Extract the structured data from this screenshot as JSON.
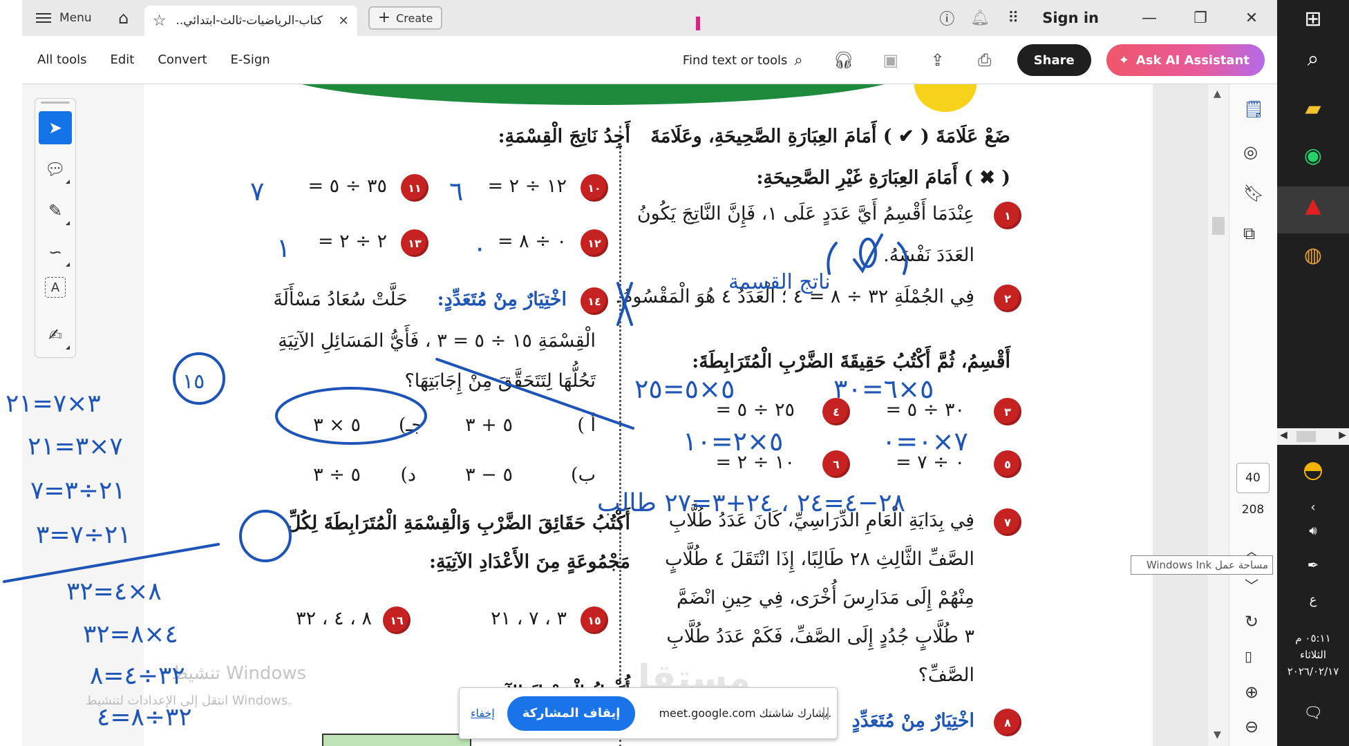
{
  "titlebar": {
    "menu_label": "Menu",
    "tab_title": "كتاب-الرياضيات-ثالث-ابتدائي..",
    "create_label": "Create",
    "sign_in_label": "Sign in"
  },
  "toolbar": {
    "all_tools": "All tools",
    "edit": "Edit",
    "convert": "Convert",
    "esign": "E-Sign",
    "find": "Find text or tools",
    "share": "Share",
    "ai_assistant": "Ask AI Assistant"
  },
  "document": {
    "right_col": {
      "heading1": "ضَعْ عَلَامَةَ ( ✔ ) أَمَامَ العِبَارَةِ الصَّحِيحَةِ، وعَلَامَةَ",
      "heading2": "( ✖ ) أَمَامَ العِبَارَةِ غَيْرِ الصَّحِيحَةِ:",
      "q1_num": "١",
      "q1_line1": "عِنْدَمَا أَقْسِمُ أَيَّ عَدَدٍ عَلَى ١، فَإِنَّ النَّاتِجَ يَكُونُ",
      "q1_line2": "العَدَدَ نَفْسَهُ.",
      "q2_num": "٢",
      "q2_text": "فِي الجُمْلَةِ ٣٢ ÷ ٨ = ٤ ؛ الْعَدَدُ ٤ هُوَ الْمَقْسُومُ.",
      "heading3": "أَقْسِمُ، ثُمَّ أَكْتُبُ حَقِيقَةَ الضَّرْبِ الْمُتَرَابِطَةَ:",
      "q3_num": "٣",
      "q3_expr": "٣٠ ÷ ٥ =",
      "q4_num": "٤",
      "q4_expr": "٢٥ ÷ ٥ =",
      "q5_num": "٥",
      "q5_expr": "٠ ÷ ٧ =",
      "q6_num": "٦",
      "q6_expr": "١٠ ÷ ٢ =",
      "q7_num": "٧",
      "q7_line1": "فِي بِدَايَةِ الْعَامِ الدِّرَاسِيِّ، كَانَ عَدَدُ طُلَّابِ",
      "q7_line2": "الصَّفِّ الثَّالِثِ ٢٨ طَالِبًا، إِذَا انْتَقَلَ ٤ طُلَّابٍ",
      "q7_line3": "مِنْهُمْ إِلَى مَدَارِسَ أُخْرَى، فِي حِينِ انْضَمَّ",
      "q7_line4": "٣ طُلَّابٍ جُدُدٍ إِلَى الصَّفِّ، فَكَمْ عَدَدُ طُلَّابِ",
      "q7_line5": "الصَّفِّ؟",
      "q8_num": "٨",
      "q8_text": "اخْتِيَارٌ مِنْ مُتَعَدِّدٍ"
    },
    "left_col": {
      "heading1": "أَجِدُ نَاتِجَ الْقِسْمَةِ:",
      "q10_num": "١٠",
      "q10_expr": "١٢ ÷ ٢ =",
      "q11_num": "١١",
      "q11_expr": "٣٥ ÷ ٥ =",
      "q12_num": "١٢",
      "q12_expr": "٠ ÷ ٨ =",
      "q13_num": "١٣",
      "q13_expr": "٢ ÷ ٢ =",
      "q14_num": "١٤",
      "q14_title": "اخْتِيَارٌ مِنْ مُتَعَدِّدٍ:",
      "q14_line1": "حَلَّتْ سُعَادُ مَسْأَلَةَ",
      "q14_line2": "الْقِسْمَةِ ١٥ ÷ ٥ = ٣ ، فَأَيُّ المَسَائِلِ الآتِيَةِ",
      "q14_line3": "تَحُلُّهَا لِتَتَحَقَّقَ مِنْ إِجَابَتِهَا؟",
      "opt_a_label": "أ )",
      "opt_a": "٥ + ٣",
      "opt_c_label": "جـ)",
      "opt_c": "٥ × ٣",
      "opt_b_label": "ب)",
      "opt_b": "٥ − ٣",
      "opt_d_label": "د)",
      "opt_d": "٥ ÷ ٣",
      "heading2": "أَكْتُبُ حَقَائِقَ الضَّرْبِ وَالْقِسْمَةِ الْمُتَرَابِطَةَ لِكُلِّ",
      "heading3": "مَجْمُوعَةٍ مِنَ الأَعْدَادِ الآتِيَةِ:",
      "q15_num": "١٥",
      "q15_set": "٣ ، ٧ ، ٢١",
      "q16_num": "١٦",
      "q16_set": "٨ ، ٤ ، ٣٢",
      "heading4": "أُكْمِلُ الْجَدْوَلَ الآتِيَ:"
    },
    "watermark_title": "تنشيط Windows",
    "watermark_sub": "انتقل إلى الإعدادات لتنشيط Windows.",
    "brand": "مستقل"
  },
  "ink": {
    "a_10": "٦",
    "a_11": "٧",
    "a_12": "٠",
    "a_13": "١",
    "a_3": "٥×٦=٣٠",
    "a_4": "٥×٥=٢٥",
    "a_5": "٧×٠=٠",
    "a_6": "٥×٢=١٠",
    "note_q2": "ناتج القسمة",
    "q7_work": "٢٨−٤=٢٤ ، ٢٤+٣=٢٧ طالب",
    "circ15": "١٥",
    "l15_1": "٣×٧=٢١",
    "l15_2": "٧×٣=٢١",
    "l15_3": "٢١÷٣=٧",
    "l15_4": "٢١÷٧=٣",
    "l16_1": "٨×٤=٣٢",
    "l16_2": "٤×٨=٣٢",
    "l16_3": "٣٢÷٤=٨",
    "l16_4": "٣٢÷٨=٤",
    "ink_color": "#1d54b8"
  },
  "reader": {
    "page_current": "40",
    "page_total": "208"
  },
  "tooltip": "مساحة عمل Windows Ink",
  "taskbar": {
    "time": "٠٥:١١ م",
    "day": "الثلاثاء",
    "date": "٢٠٢٦/٠٢/١٧",
    "lang": "ع"
  },
  "sharebar": {
    "hide": "إخفاء",
    "stop": "إيقاف المشاركة",
    "message": "meet.google.com يشارك شاشتك."
  }
}
